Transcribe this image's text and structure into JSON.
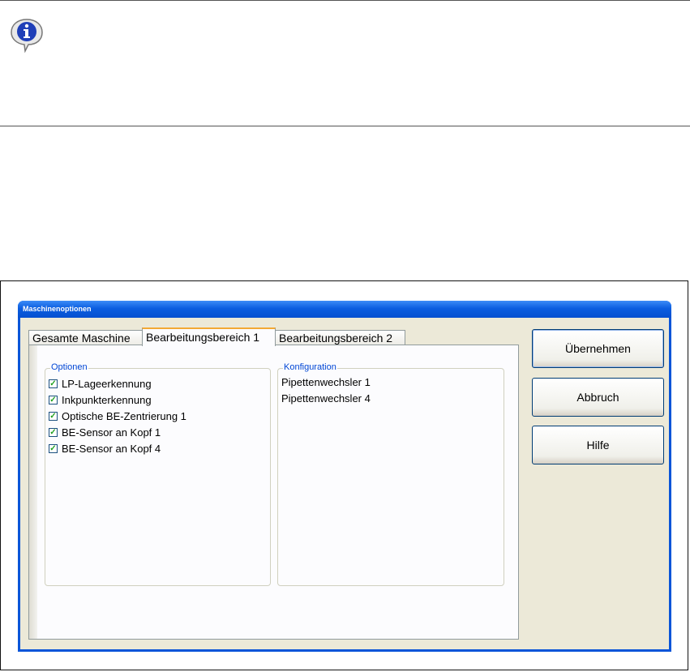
{
  "window": {
    "title": "Maschinenoptionen"
  },
  "tabs": [
    {
      "label": "Gesamte Maschine",
      "active": false
    },
    {
      "label": "Bearbeitungsbereich 1",
      "active": true
    },
    {
      "label": "Bearbeitungsbereich 2",
      "active": false
    }
  ],
  "options_group": {
    "legend": "Optionen",
    "items": [
      {
        "label": "LP-Lageerkennung",
        "checked": true
      },
      {
        "label": "Inkpunkterkennung",
        "checked": true
      },
      {
        "label": "Optische BE-Zentrierung 1",
        "checked": true
      },
      {
        "label": "BE-Sensor an Kopf 1",
        "checked": true
      },
      {
        "label": "BE-Sensor an Kopf 4",
        "checked": true
      }
    ]
  },
  "config_group": {
    "legend": "Konfiguration",
    "items": [
      "Pipettenwechsler 1",
      "Pipettenwechsler 4"
    ]
  },
  "buttons": {
    "apply": "Übernehmen",
    "cancel": "Abbruch",
    "help": "Hilfe"
  },
  "icons": {
    "info": "info-speech-bubble-icon",
    "check": "checkmark-icon"
  },
  "colors": {
    "titlebar": "#0b5ee0",
    "tab_active_accent": "#f3a935",
    "legend_text": "#0046d5",
    "check": "#21a121"
  }
}
